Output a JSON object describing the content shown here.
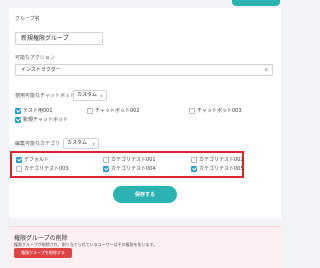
{
  "group_name": {
    "label": "グループ名",
    "value": "新規権限グループ"
  },
  "actions": {
    "label": "可能なアクション",
    "selected": "インストラクター"
  },
  "usable_chatbots": {
    "label": "使用可能なチャットボット",
    "mode": "カスタム",
    "items": [
      {
        "label": "テスト用001",
        "checked": true
      },
      {
        "label": "チャットボット002",
        "checked": false
      },
      {
        "label": "チャットボット003",
        "checked": false
      },
      {
        "label": "新規チャットボット",
        "checked": true
      }
    ]
  },
  "editable_categories": {
    "label": "編集可能なカテゴリ",
    "mode": "カスタム",
    "items": [
      {
        "label": "デフォルト",
        "checked": true
      },
      {
        "label": "カテゴリテスト001",
        "checked": false
      },
      {
        "label": "カテゴリテスト002",
        "checked": false
      },
      {
        "label": "カテゴリテスト003",
        "checked": false
      },
      {
        "label": "カテゴリテスト004",
        "checked": true
      },
      {
        "label": "カテゴリテスト005",
        "checked": true
      }
    ]
  },
  "save_label": "保存する",
  "delete_section": {
    "title": "権限グループの削除",
    "description": "権限グループが削除され、割り当てられているユーザーはその権限を失います。",
    "button": "権限グループを削除する"
  },
  "colors": {
    "accent": "#2bb3b1",
    "checkbox": "#2a9fc4",
    "highlight": "#e0242d",
    "danger": "#dd4545"
  }
}
